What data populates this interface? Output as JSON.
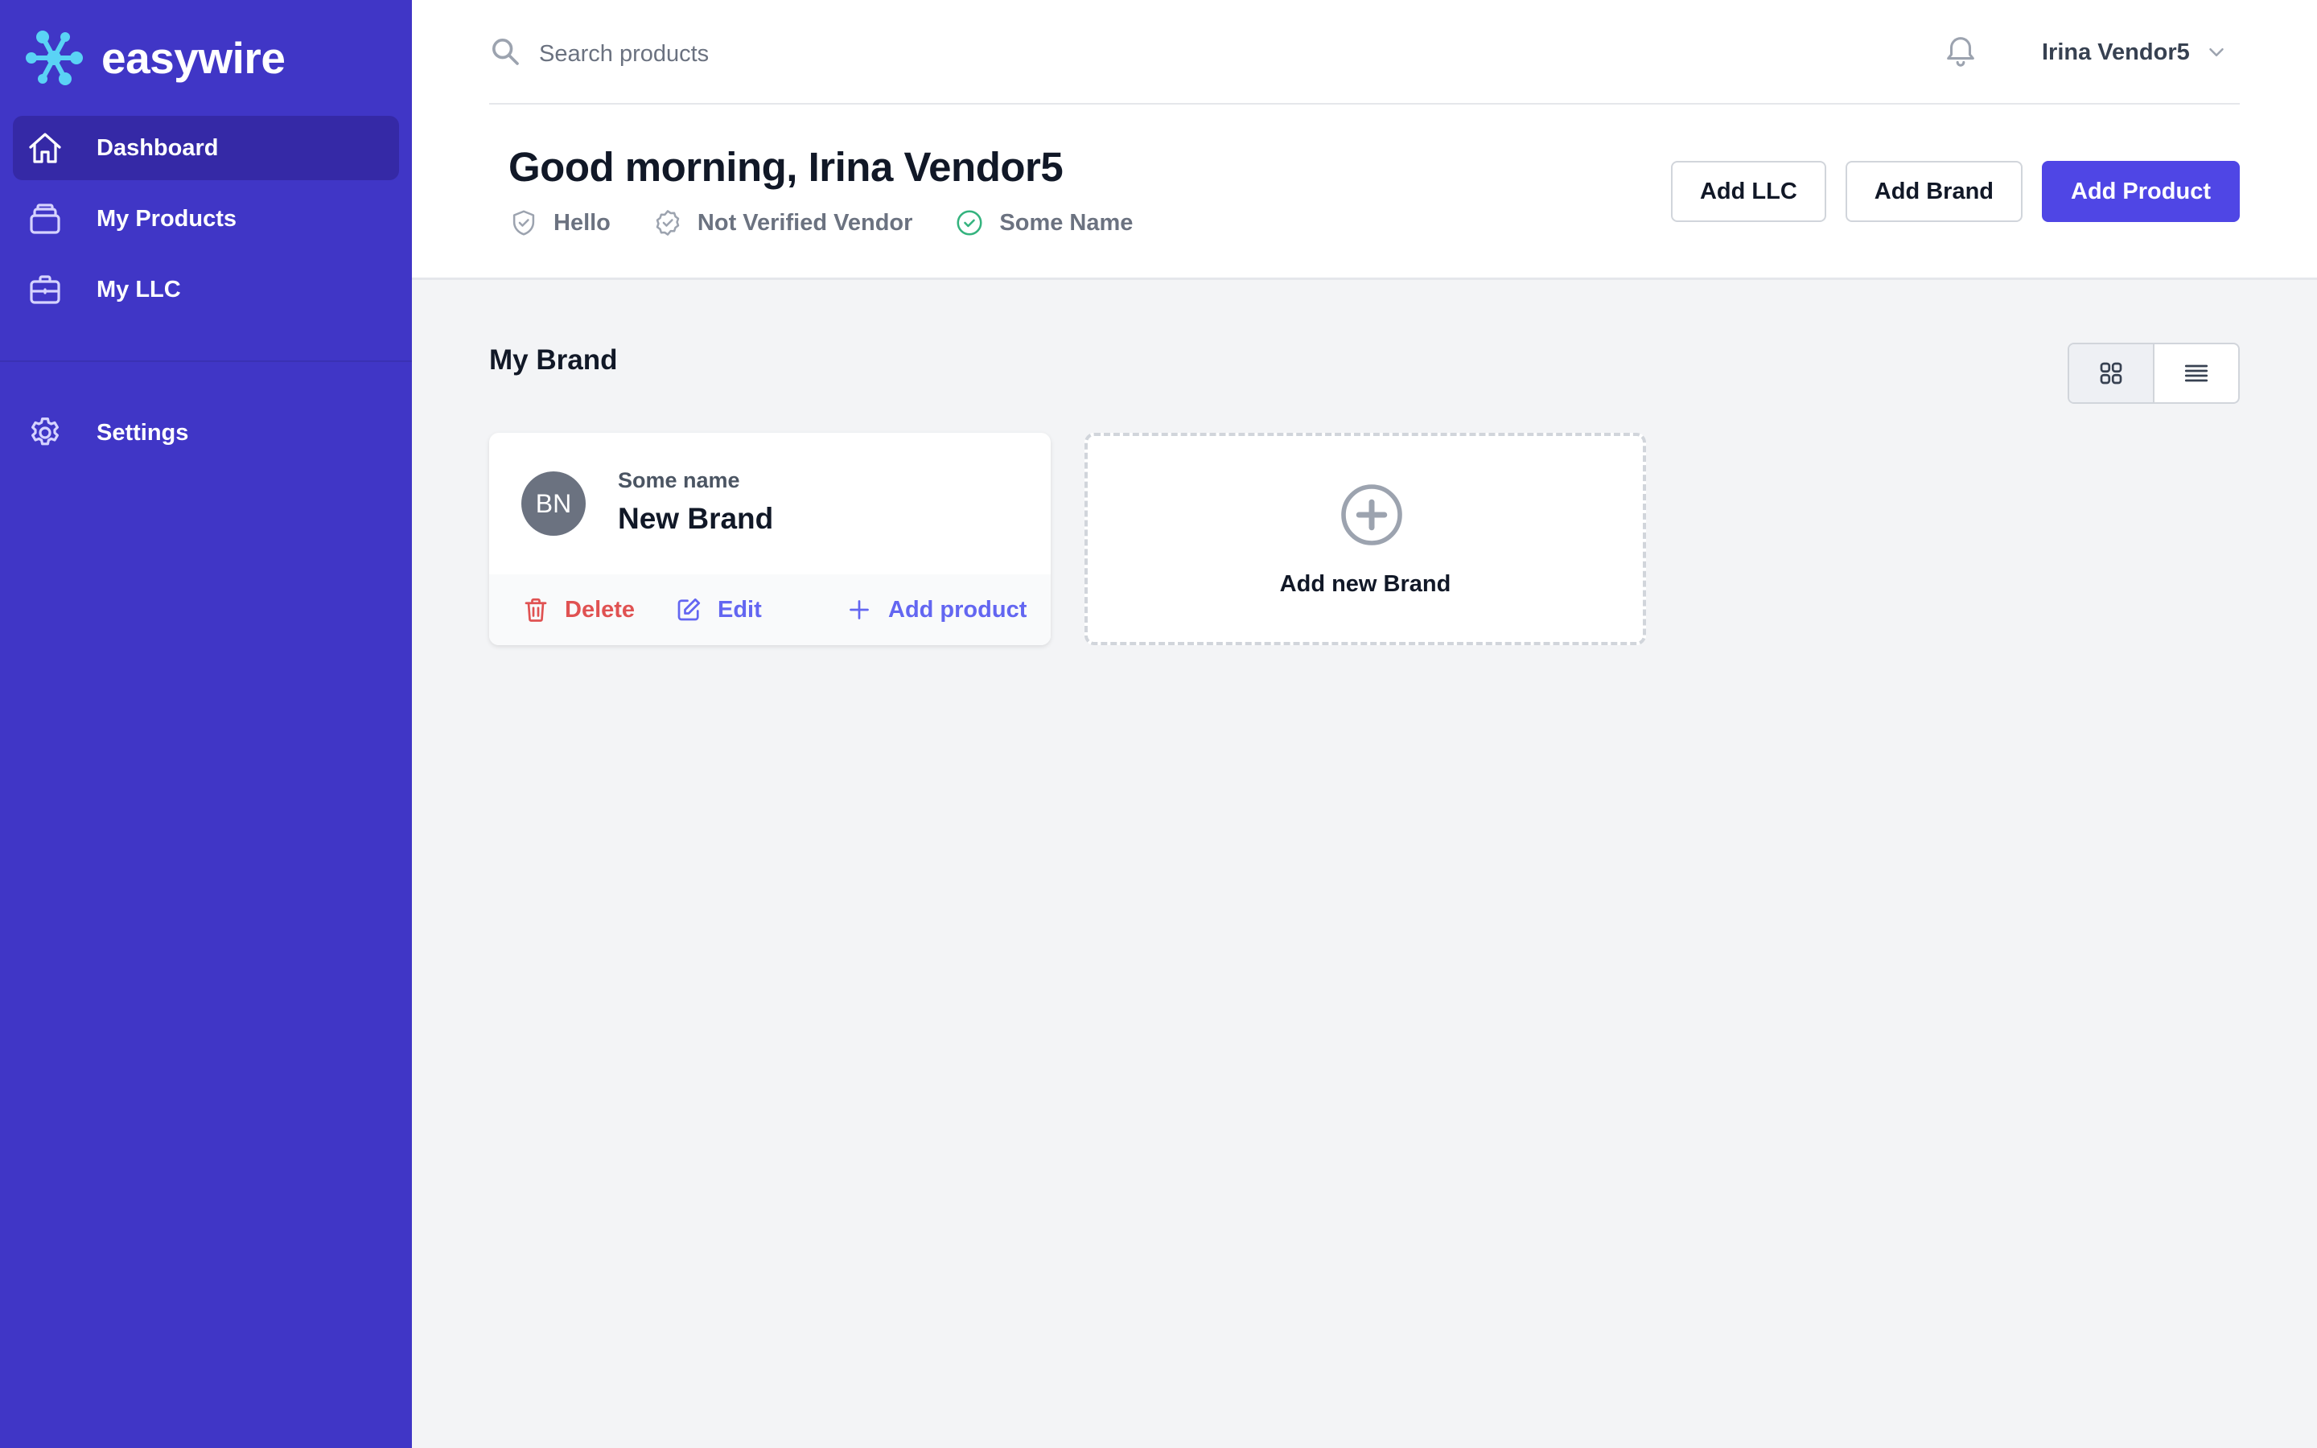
{
  "app": {
    "logo_text": "easywire"
  },
  "sidebar": {
    "items": [
      {
        "label": "Dashboard",
        "icon": "home-icon",
        "active": true
      },
      {
        "label": "My Products",
        "icon": "stack-icon"
      },
      {
        "label": "My LLC",
        "icon": "briefcase-icon"
      }
    ],
    "secondary": [
      {
        "label": "Settings",
        "icon": "gear-icon"
      }
    ]
  },
  "header": {
    "search_placeholder": "Search products",
    "user_name": "Irina Vendor5",
    "greeting": "Good morning, Irina Vendor5",
    "badges": [
      {
        "label": "Hello",
        "icon": "shield-check-icon"
      },
      {
        "label": "Not Verified Vendor",
        "icon": "badge-check-icon"
      },
      {
        "label": "Some Name",
        "icon": "check-circle-icon"
      }
    ],
    "actions": {
      "add_llc": "Add LLC",
      "add_brand": "Add Brand",
      "add_product": "Add Product"
    }
  },
  "main": {
    "section_title": "My Brand",
    "brands": [
      {
        "initials": "BN",
        "subtitle": "Some name",
        "name": "New Brand",
        "actions": {
          "delete": "Delete",
          "edit": "Edit",
          "add_product": "Add product"
        }
      }
    ],
    "add_new_brand_label": "Add new Brand"
  },
  "colors": {
    "sidebar_bg": "#4036c6",
    "sidebar_active": "#3529a6",
    "primary": "#4f46e5",
    "danger": "#e05252",
    "success": "#34b37e",
    "logo_accent": "#5ad3f5"
  }
}
